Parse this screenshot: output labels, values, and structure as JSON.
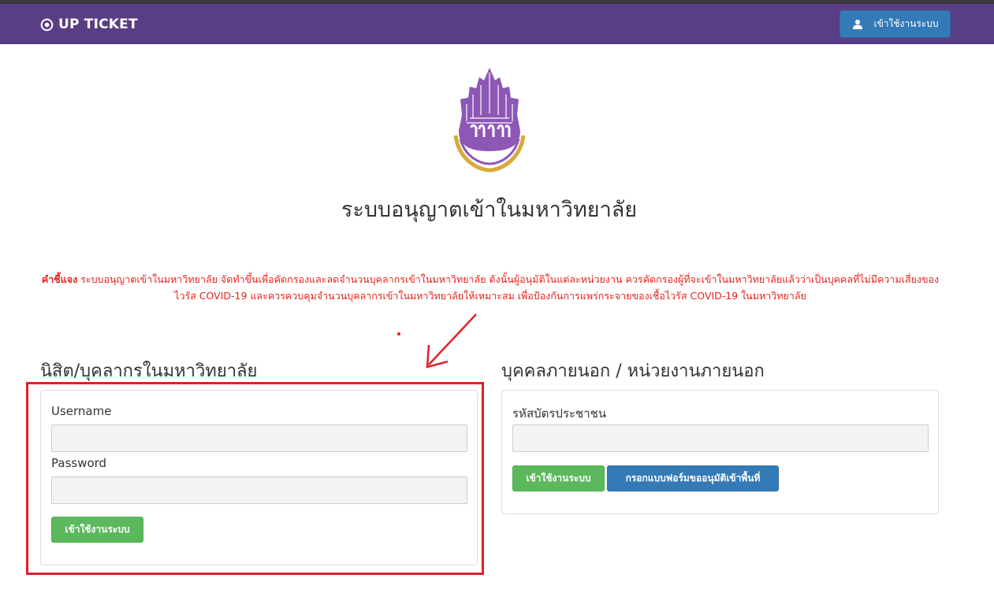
{
  "navbar": {
    "brand": "UP TICKET",
    "login_button": "เข้าใช้งานระบบ"
  },
  "header": {
    "logo_text": "มหาวิทยาลัยพะเยา",
    "title": "ระบบอนุญาตเข้าในมหาวิทยาลัย"
  },
  "notice": {
    "label": "คำชี้แจง",
    "text": " ระบบอนุญาตเข้าในมหาวิทยาลัย จัดทำขึ้นเพื่อคัดกรองและลดจำนวนบุคลากรเข้าในมหาวิทยาลัย ดังนั้นผู้อนุมัติในแต่ละหน่วยงาน ควรคัดกรองผู้ที่จะเข้าในมหาวิทยาลัยแล้วว่าเป็นบุคคลที่ไม่มีความเสี่ยงของไวรัส COVID-19 และควรควบคุมจำนวนบุคลากรเข้าในมหาวิทยาลัยให้เหมาะสม เพื่อป้องกันการแพร่กระจายของเชื้อไวรัส COVID-19 ในมหาวิทยาลัย"
  },
  "internal": {
    "title": "นิสิต/บุคลากรในมหาวิทยาลัย",
    "username_label": "Username",
    "username_value": "",
    "password_label": "Password",
    "password_value": "",
    "login_button": "เข้าใช้งานระบบ"
  },
  "external": {
    "title": "บุคคลภายนอก / หน่วยงานภายนอก",
    "id_label": "รหัสบัตรประชาชน",
    "id_value": "",
    "login_button": "เข้าใช้งานระบบ",
    "form_button": "กรอกแบบฟอร์มขออนุมัติเข้าพื้นที่"
  },
  "colors": {
    "navbar": "#5a3e85",
    "primary": "#337ab7",
    "success": "#5cb85c",
    "notice": "#e8231b",
    "annotation": "#e0202b"
  }
}
